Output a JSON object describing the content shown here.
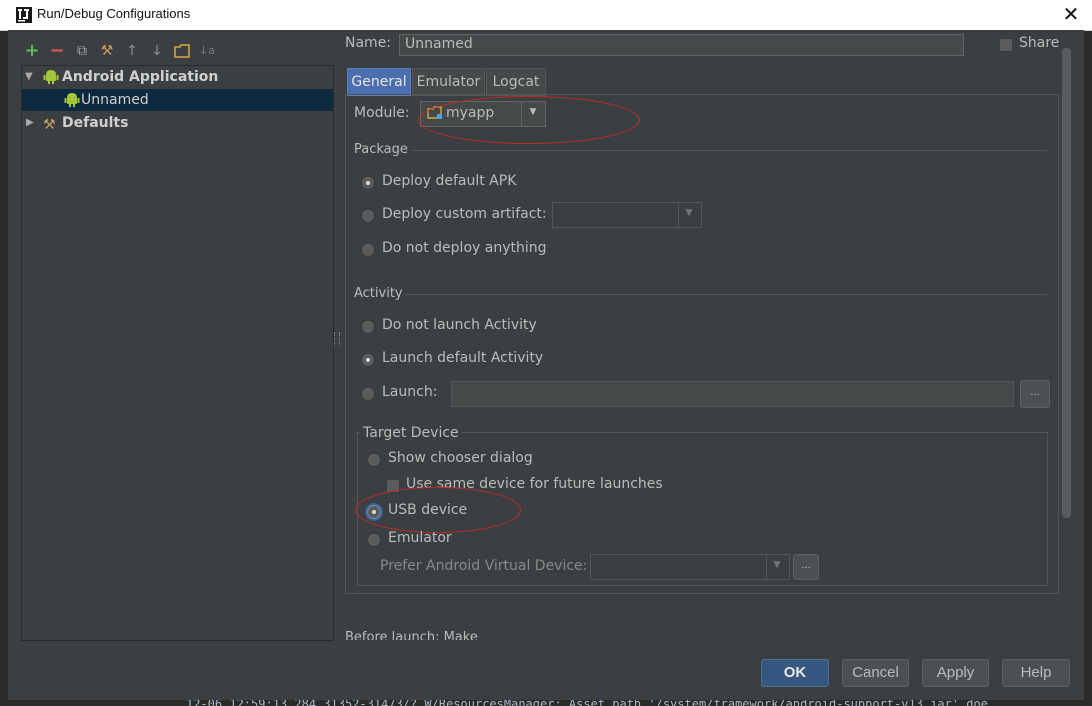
{
  "window": {
    "title": "Run/Debug Configurations",
    "close_glyph": "✕"
  },
  "toolbar": {
    "add": "+",
    "remove": "−",
    "copy": "⧉",
    "edit_defaults": "⚒",
    "move_up": "↑",
    "move_down": "↓",
    "folder": "▭",
    "sort": "↓a"
  },
  "tree": {
    "items": [
      {
        "label": "Android Application",
        "expanded": true
      },
      {
        "label": "Unnamed",
        "selected": true
      },
      {
        "label": "Defaults",
        "expanded": false
      }
    ]
  },
  "config": {
    "name_label": "Name:",
    "name_value": "Unnamed",
    "share_label": "Share",
    "tabs": [
      "General",
      "Emulator",
      "Logcat"
    ],
    "active_tab": "General",
    "module_label": "Module:",
    "module_value": "myapp",
    "package": {
      "title": "Package",
      "options": [
        "Deploy default APK",
        "Deploy custom artifact:",
        "Do not deploy anything"
      ],
      "selected": "Deploy default APK"
    },
    "activity": {
      "title": "Activity",
      "options": [
        "Do not launch Activity",
        "Launch default Activity",
        "Launch:"
      ],
      "selected": "Launch default Activity"
    },
    "target": {
      "title": "Target Device",
      "show_chooser": "Show chooser dialog",
      "same_device": "Use same device for future launches",
      "usb": "USB device",
      "emulator": "Emulator",
      "prefer_avd": "Prefer Android Virtual Device:",
      "selected": "USB device"
    },
    "ellipsis": "...",
    "before_launch": "Before launch: Make"
  },
  "buttons": {
    "ok": "OK",
    "cancel": "Cancel",
    "apply": "Apply",
    "help": "Help"
  },
  "background": {
    "log_line": "12-06 12:59:13.284 31352-31473/? W/ResourcesManager: Asset path '/system/framework/android-support-v13.jar' doe"
  },
  "colors": {
    "panel": "#3c3f41",
    "selection": "#0d293e",
    "accent_button": "#365880",
    "annotation": "#c0292b",
    "android_green": "#a4c639"
  }
}
